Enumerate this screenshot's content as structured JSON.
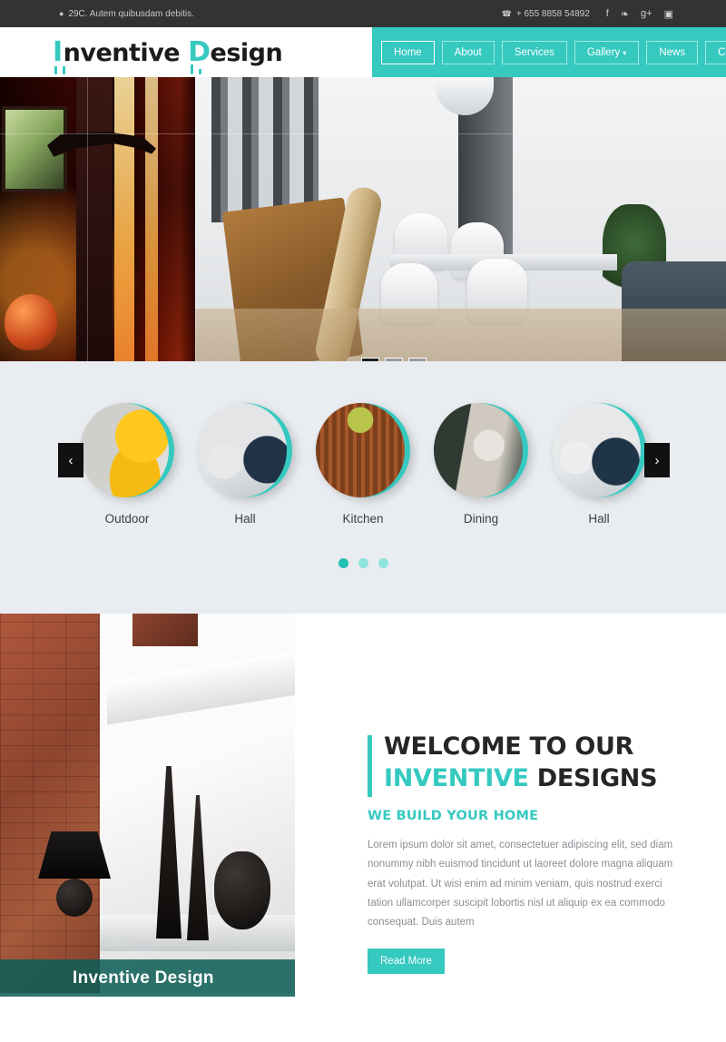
{
  "topbar": {
    "address": "29C. Autem quibusdam debitis.",
    "phone": "+ 655 8858 54892",
    "location_icon": "map-pin-icon",
    "phone_icon": "phone-icon",
    "socials": [
      {
        "name": "facebook-icon",
        "glyph": "f"
      },
      {
        "name": "twitter-icon",
        "glyph": "❧"
      },
      {
        "name": "google-plus-icon",
        "glyph": "g+"
      },
      {
        "name": "instagram-icon",
        "glyph": "▣"
      }
    ]
  },
  "logo": {
    "cap1": "I",
    "word1": "nventive",
    "cap2": "D",
    "word2": "esign"
  },
  "nav": {
    "items": [
      {
        "label": "Home",
        "active": true
      },
      {
        "label": "About",
        "active": false
      },
      {
        "label": "Services",
        "active": false
      },
      {
        "label": "Gallery",
        "active": false,
        "caret": "▾"
      },
      {
        "label": "News",
        "active": false
      },
      {
        "label": "Contact",
        "active": false
      }
    ]
  },
  "hero": {
    "slides": 3,
    "active_slide": 1
  },
  "gallery": {
    "items": [
      {
        "label": "Outdoor"
      },
      {
        "label": "Hall"
      },
      {
        "label": "Kitchen"
      },
      {
        "label": "Dining"
      },
      {
        "label": "Hall"
      }
    ],
    "prev_arrow": "‹",
    "next_arrow": "›",
    "dots": 3,
    "active_dot": 1
  },
  "welcome": {
    "heading_line1": "WELCOME TO OUR",
    "heading_accent": "INVENTIVE",
    "heading_rest": "DESIGNS",
    "subheading": "WE BUILD YOUR HOME",
    "paragraph": "Lorem ipsum dolor sit amet, consectetuer adipiscing elit, sed diam nonummy nibh euismod tincidunt ut laoreet dolore magna aliquam erat volutpat. Ut wisi enim ad minim veniam, quis nostrud exerci tation ullamcorper suscipit lobortis nisl ut aliquip ex ea commodo consequat. Duis autem",
    "button_label": "Read More",
    "image_caption": "Inventive Design"
  },
  "colors": {
    "accent": "#35c9c0",
    "topbar_bg": "#333333",
    "gallery_bg": "#e9ecf0",
    "caption_bg": "#0d5e56"
  }
}
